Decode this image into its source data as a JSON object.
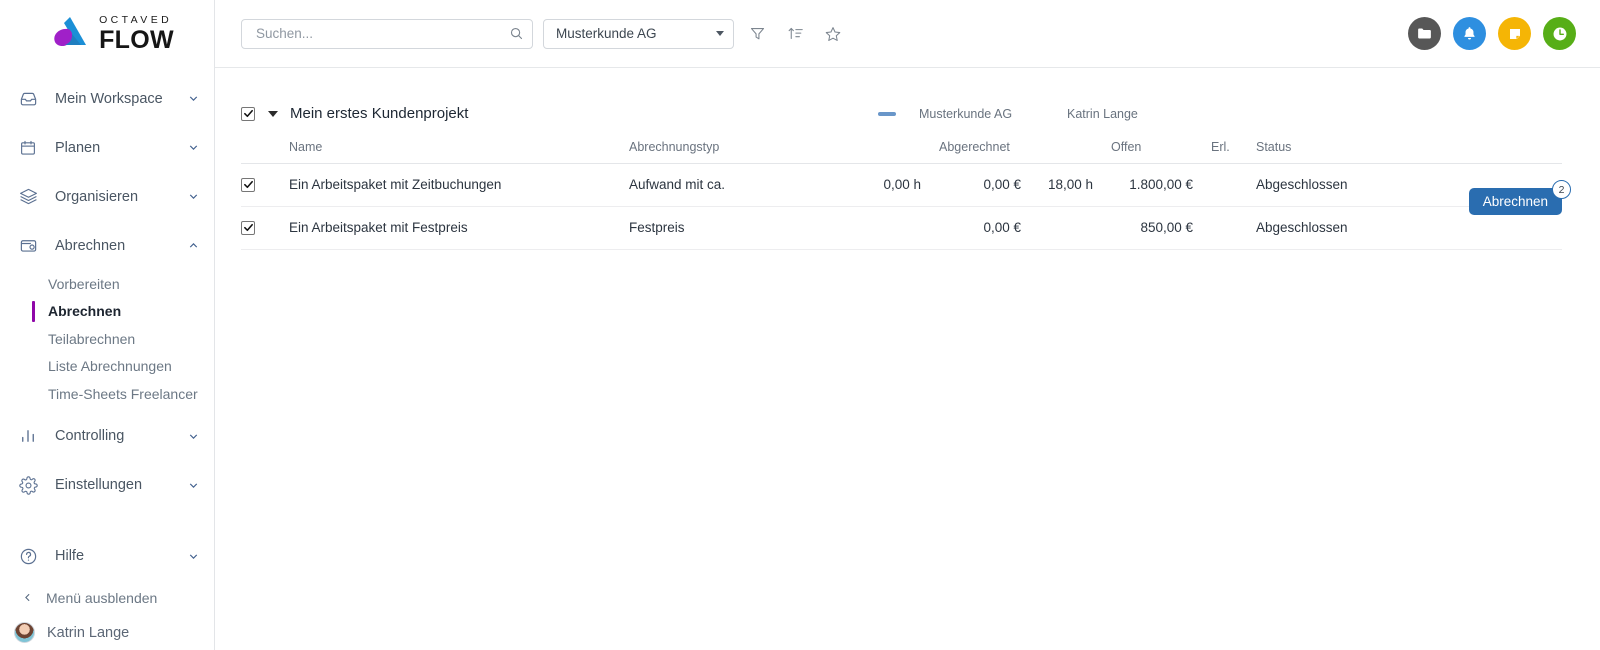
{
  "brand": {
    "logo_top": "OCTAVED",
    "logo_bottom": "FLOW",
    "accent_purple": "#8f07a8",
    "accent_blue": "#2a6db0"
  },
  "sidebar": {
    "items": [
      {
        "label": "Mein Workspace",
        "icon": "inbox-icon",
        "chevron": "chevron-down-icon",
        "expanded": false
      },
      {
        "label": "Planen",
        "icon": "calendar-icon",
        "chevron": "chevron-down-icon",
        "expanded": false
      },
      {
        "label": "Organisieren",
        "icon": "layers-icon",
        "chevron": "chevron-down-icon",
        "expanded": false
      },
      {
        "label": "Abrechnen",
        "icon": "wallet-icon",
        "chevron": "chevron-up-icon",
        "expanded": true
      },
      {
        "label": "Controlling",
        "icon": "bar-chart-icon",
        "chevron": "chevron-down-icon",
        "expanded": false
      },
      {
        "label": "Einstellungen",
        "icon": "gear-icon",
        "chevron": "chevron-down-icon",
        "expanded": false
      },
      {
        "label": "Hilfe",
        "icon": "question-circle-icon",
        "chevron": "chevron-down-icon",
        "expanded": false
      }
    ],
    "subitems": [
      {
        "label": "Vorbereiten",
        "active": false
      },
      {
        "label": "Abrechnen",
        "active": true
      },
      {
        "label": "Teilabrechnen",
        "active": false
      },
      {
        "label": "Liste Abrechnungen",
        "active": false
      },
      {
        "label": "Time-Sheets Freelancer",
        "active": false
      }
    ],
    "hide_menu_label": "Menü ausblenden",
    "hide_menu_icon": "chevron-left-icon",
    "user_name": "Katrin Lange"
  },
  "topbar": {
    "search": {
      "placeholder": "Suchen...",
      "value": "",
      "icon": "search-icon"
    },
    "customer_select": {
      "value": "Musterkunde AG",
      "icon": "chevron-down-icon"
    },
    "tools": [
      {
        "name": "filter-icon",
        "label": "Filter"
      },
      {
        "name": "sort-ascending-icon",
        "label": "Sortieren"
      },
      {
        "name": "star-icon",
        "label": "Favorit"
      }
    ],
    "actions": [
      {
        "name": "folder-icon",
        "color": "#575757"
      },
      {
        "name": "bell-icon",
        "color": "#2e8fe0"
      },
      {
        "name": "note-icon",
        "color": "#f5b505"
      },
      {
        "name": "clock-icon",
        "color": "#57ae17"
      }
    ]
  },
  "project": {
    "checked": true,
    "expanded": true,
    "name": "Mein erstes Kundenprojekt",
    "status_dash_color": "#6996c9",
    "customer": "Musterkunde AG",
    "owner": "Katrin Lange",
    "action_button": {
      "label": "Abrechnen",
      "badge": "2"
    }
  },
  "table": {
    "columns": [
      {
        "key": "checkbox",
        "label": ""
      },
      {
        "key": "name",
        "label": "Name"
      },
      {
        "key": "typ",
        "label": "Abrechnungstyp"
      },
      {
        "key": "abgerechnet_h",
        "label": ""
      },
      {
        "key": "abgerechnet_e",
        "label": "Abgerechnet"
      },
      {
        "key": "offen_h",
        "label": ""
      },
      {
        "key": "offen_e",
        "label": "Offen"
      },
      {
        "key": "erl",
        "label": "Erl."
      },
      {
        "key": "status",
        "label": "Status"
      }
    ],
    "rows": [
      {
        "checked": true,
        "name": "Ein Arbeitspaket mit Zeitbuchungen",
        "typ": "Aufwand mit ca.",
        "abgerechnet_h": "0,00 h",
        "abgerechnet_e": "0,00 €",
        "offen_h": "18,00 h",
        "offen_e": "1.800,00 €",
        "erl": "",
        "status": "Abgeschlossen"
      },
      {
        "checked": true,
        "name": "Ein Arbeitspaket mit Festpreis",
        "typ": "Festpreis",
        "abgerechnet_h": "",
        "abgerechnet_e": "0,00 €",
        "offen_h": "",
        "offen_e": "850,00 €",
        "erl": "",
        "status": "Abgeschlossen"
      }
    ]
  }
}
